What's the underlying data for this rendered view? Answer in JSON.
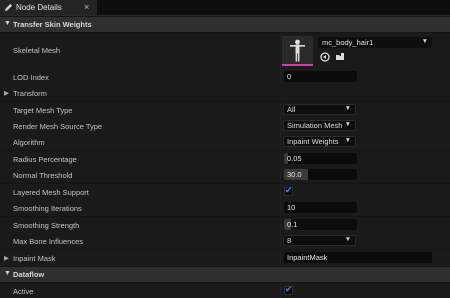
{
  "tab": {
    "title": "Node Details",
    "close_glyph": "×"
  },
  "sections": {
    "transfer": "Transfer Skin Weights",
    "dataflow": "Dataflow"
  },
  "skeletal_mesh": {
    "label": "Skeletal Mesh",
    "asset": "mc_body_hair1"
  },
  "rows": {
    "lod_index": {
      "label": "LOD Index",
      "value": "0"
    },
    "transform": {
      "label": "Transform"
    },
    "target_mesh_type": {
      "label": "Target Mesh Type",
      "value": "All"
    },
    "render_mesh_source_type": {
      "label": "Render Mesh Source Type",
      "value": "Simulation Mesh"
    },
    "algorithm": {
      "label": "Algorithm",
      "value": "Inpaint Weights"
    },
    "radius_percentage": {
      "label": "Radius Percentage",
      "value": "0.05",
      "fill_fraction": 0.05
    },
    "normal_threshold": {
      "label": "Normal Threshold",
      "value": "30.0",
      "fill_fraction": 0.33
    },
    "layered_mesh_support": {
      "label": "Layered Mesh Support",
      "checked": true
    },
    "smoothing_iterations": {
      "label": "Smoothing Iterations",
      "value": "10"
    },
    "smoothing_strength": {
      "label": "Smoothing Strength",
      "value": "0.1",
      "fill_fraction": 0.1
    },
    "max_bone_influences": {
      "label": "Max Bone Influences",
      "value": "8"
    },
    "inpaint_mask": {
      "label": "Inpaint Mask",
      "value": "InpaintMask"
    },
    "active": {
      "label": "Active",
      "checked": true
    }
  },
  "icons": {
    "tab": "pencil-icon",
    "expand": "triangle-down",
    "collapsed": "triangle-right",
    "combo": "chevron-down",
    "check": "✔"
  },
  "colors": {
    "accent_check": "#2f8cff",
    "asset_underline": "#d63ea6"
  }
}
